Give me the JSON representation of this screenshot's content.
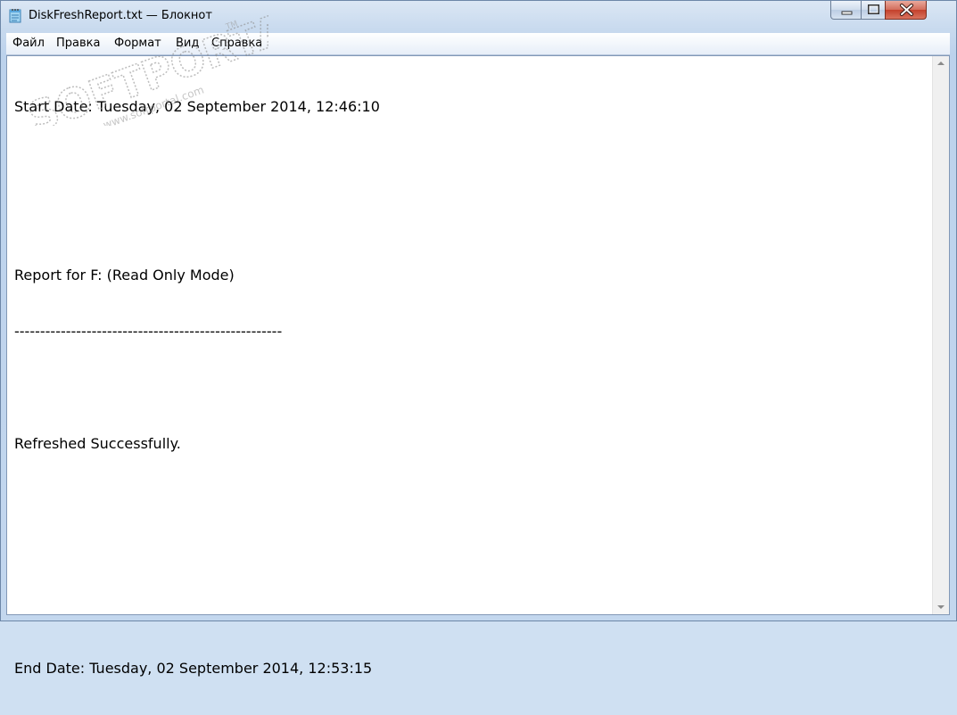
{
  "window": {
    "title": "DiskFreshReport.txt — Блокнот"
  },
  "menu": {
    "items": [
      "Файл",
      "Правка",
      "Формат",
      "Вид",
      "Справка"
    ]
  },
  "document": {
    "lines": [
      "Start Date: Tuesday, 02 September 2014, 12:46:10",
      "",
      "",
      "Report for F: (Read Only Mode)",
      "----------------------------------------------------",
      "",
      "Refreshed Successfully.",
      "",
      "",
      "",
      "End Date: Tuesday, 02 September 2014, 12:53:15"
    ]
  },
  "watermark": {
    "brand": "SOFTPORTAL",
    "url": "www.softportal.com",
    "tm": "TM"
  },
  "icons": {
    "app": "notepad-icon",
    "minimize": "minimize-icon",
    "maximize": "maximize-icon",
    "close": "close-icon",
    "scroll_up": "scroll-up-icon",
    "scroll_down": "scroll-down-icon"
  },
  "colors": {
    "frame": "#c7d9ee",
    "close_button": "#c3402b",
    "editor_bg": "#ffffff"
  }
}
